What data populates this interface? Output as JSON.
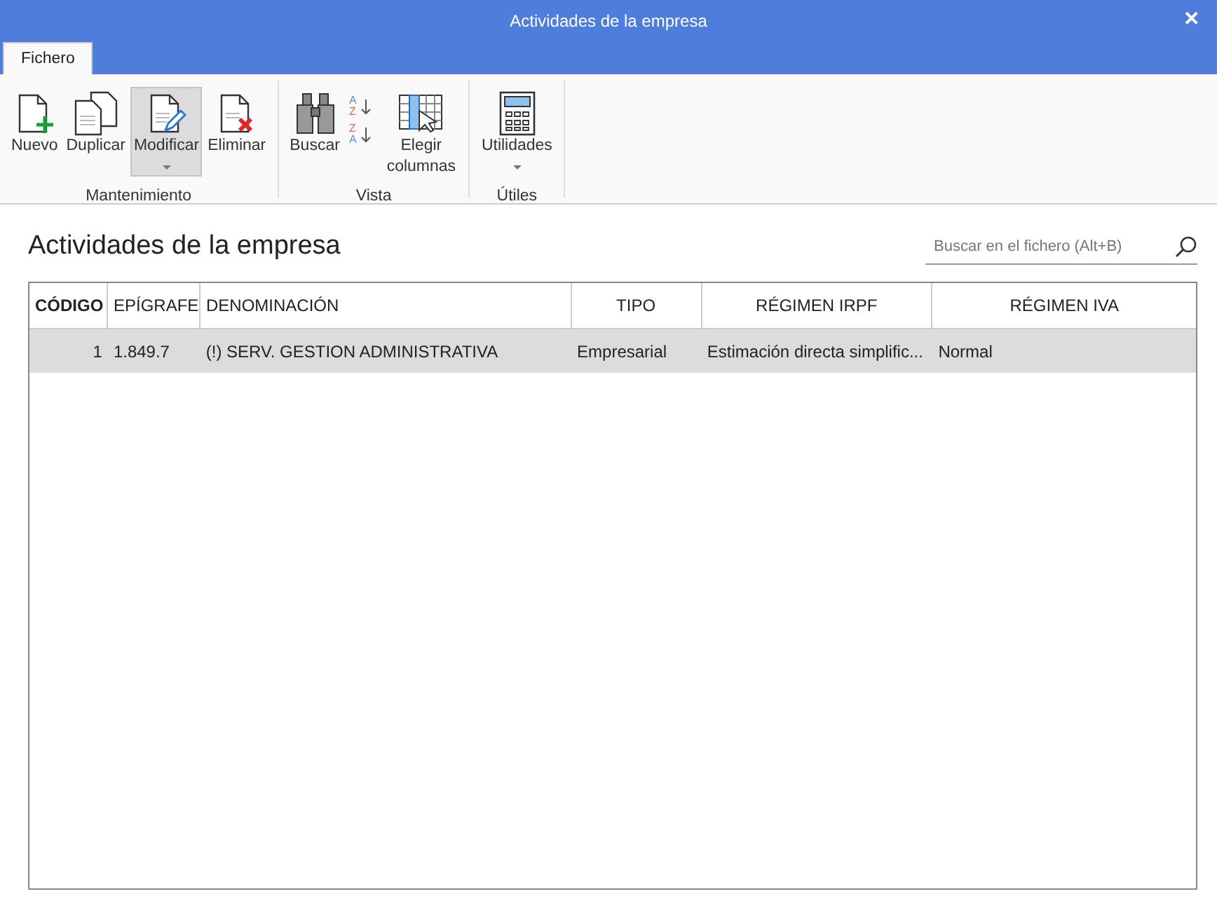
{
  "window": {
    "title": "Actividades de la empresa",
    "close": "✕"
  },
  "tabs": [
    {
      "label": "Fichero",
      "selected": true
    }
  ],
  "ribbon": {
    "groups": [
      {
        "label": "Mantenimiento",
        "buttons": [
          {
            "kind": "new",
            "label": "Nuevo",
            "selected": false,
            "has_menu": false
          },
          {
            "kind": "duplicate",
            "label": "Duplicar",
            "selected": false,
            "has_menu": false
          },
          {
            "kind": "edit",
            "label": "Modificar",
            "selected": true,
            "has_menu": true
          },
          {
            "kind": "delete",
            "label": "Eliminar",
            "selected": false,
            "has_menu": false
          }
        ]
      },
      {
        "label": "Vista",
        "buttons": [
          {
            "kind": "find",
            "label": "Buscar",
            "selected": false,
            "has_menu": false
          },
          {
            "kind": "sort",
            "letters": [
              "A",
              "Z",
              "Z",
              "A"
            ],
            "selected": false,
            "has_menu": false
          },
          {
            "kind": "columns",
            "label": "Elegir columnas",
            "selected": false,
            "has_menu": false
          }
        ]
      },
      {
        "label": "Útiles",
        "buttons": [
          {
            "kind": "calc",
            "label": "Utilidades",
            "selected": false,
            "has_menu": true
          }
        ]
      }
    ]
  },
  "heading": "Actividades de la empresa",
  "search": {
    "placeholder": "Buscar en el fichero (Alt+B)"
  },
  "table": {
    "columns": [
      {
        "label": "CÓDIGO",
        "bold": true
      },
      {
        "label": "EPÍGRAFE",
        "bold": false
      },
      {
        "label": "DENOMINACIÓN",
        "bold": false
      },
      {
        "label": "TIPO",
        "bold": false
      },
      {
        "label": "RÉGIMEN IRPF",
        "bold": false
      },
      {
        "label": "RÉGIMEN IVA",
        "bold": false
      }
    ],
    "rows": [
      {
        "selected": true,
        "cells": [
          "1",
          "1.849.7",
          "(!) SERV. GESTION ADMINISTRATIVA",
          "Empresarial",
          "Estimación directa simplific...",
          "Normal"
        ]
      }
    ]
  }
}
